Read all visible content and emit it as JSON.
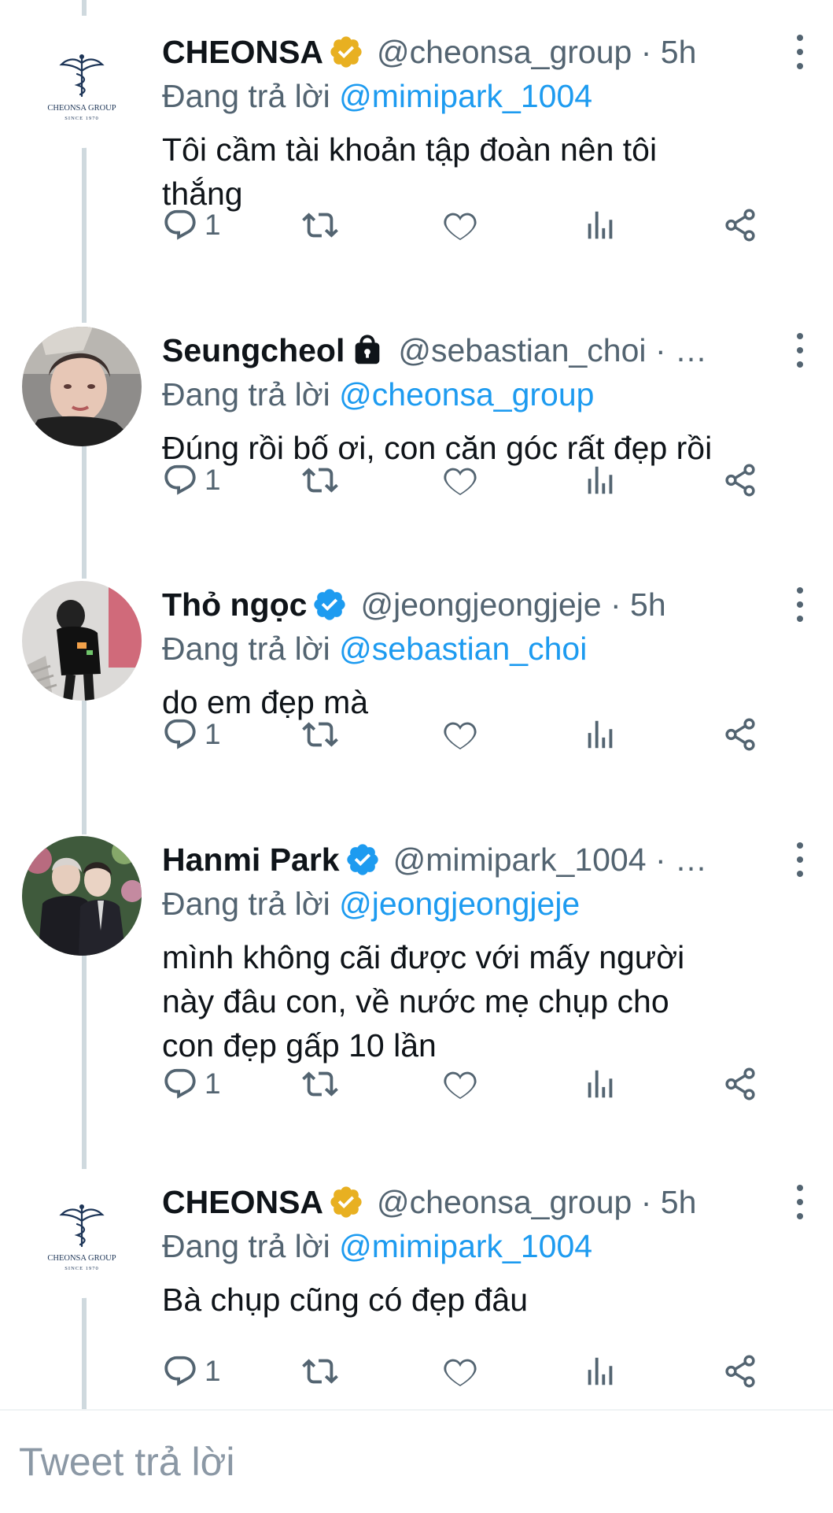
{
  "reply_prefix": "Đang trả lời",
  "tweets": [
    {
      "name": "CHEONSA",
      "handle": "@cheonsa_group",
      "time": "5h",
      "time_separator": "·",
      "badge": "gold-verified",
      "replying_to": "@mimipark_1004",
      "text_lines": [
        "Tôi cầm tài khoản tập đoàn nên tôi",
        "thắng"
      ],
      "reply_count": "1",
      "avatar_logo_text": "CHEONSA GROUP",
      "avatar_logo_sub": "SINCE 1970"
    },
    {
      "name": "Seungcheol",
      "handle": "@sebastian_choi",
      "time": "…",
      "time_separator": "·",
      "badge": "lock",
      "replying_to": "@cheonsa_group",
      "text_lines": [
        "Đúng rồi bố ơi, con căn góc rất đẹp rồi"
      ],
      "reply_count": "1"
    },
    {
      "name": "Thỏ ngọc",
      "handle": "@jeongjeongjeje",
      "time": "5h",
      "time_separator": "·",
      "badge": "blue-verified",
      "replying_to": "@sebastian_choi",
      "text_lines": [
        "do em đẹp mà"
      ],
      "reply_count": "1"
    },
    {
      "name": "Hanmi Park",
      "handle": "@mimipark_1004",
      "time": "…",
      "time_separator": "·",
      "badge": "blue-verified",
      "replying_to": "@jeongjeongjeje",
      "text_lines": [
        "mình không cãi được với mấy người",
        "này đâu con, về nước mẹ chụp cho",
        "con đẹp gấp 10 lần"
      ],
      "reply_count": "1"
    },
    {
      "name": "CHEONSA",
      "handle": "@cheonsa_group",
      "time": "5h",
      "time_separator": "·",
      "badge": "gold-verified",
      "replying_to": "@mimipark_1004",
      "text_lines": [
        "Bà chụp cũng có đẹp đâu"
      ],
      "reply_count": "1",
      "avatar_logo_text": "CHEONSA GROUP",
      "avatar_logo_sub": "SINCE 1970"
    }
  ],
  "action_icons": [
    "reply-icon",
    "retweet-icon",
    "like-icon",
    "analytics-icon",
    "share-icon"
  ],
  "composer": {
    "placeholder": "Tweet trả lời"
  },
  "colors": {
    "link": "#1d9bf0",
    "secondary_text": "#536471",
    "gold_badge": "#e8b021",
    "blue_badge": "#1d9bf0",
    "thread_line": "#cfd9de",
    "logo_navy": "#1d3557"
  }
}
